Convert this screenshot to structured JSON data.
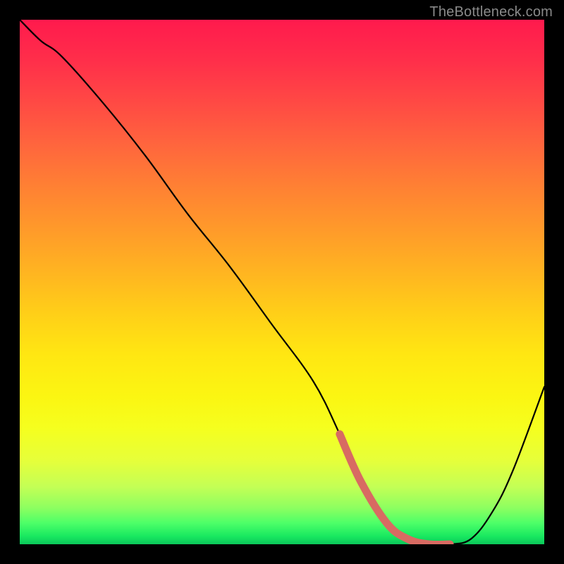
{
  "watermark": "TheBottleneck.com",
  "colors": {
    "background": "#000000",
    "curve": "#000000",
    "highlight": "#d86a62",
    "watermark_text": "#8a8a8a"
  },
  "chart_data": {
    "type": "line",
    "title": "",
    "xlabel": "",
    "ylabel": "",
    "xlim": [
      0,
      100
    ],
    "ylim": [
      0,
      100
    ],
    "grid": false,
    "legend": false,
    "series": [
      {
        "name": "bottleneck-curve",
        "x": [
          0,
          4,
          8,
          16,
          24,
          32,
          40,
          48,
          56,
          61,
          65,
          70,
          74,
          78,
          82,
          86,
          90,
          94,
          100
        ],
        "values": [
          100,
          96,
          93,
          84,
          74,
          63,
          53,
          42,
          31,
          21,
          12,
          4,
          1,
          0,
          0,
          1,
          6,
          14,
          30
        ]
      }
    ],
    "highlight_range_x": [
      61,
      82
    ],
    "annotations": []
  }
}
